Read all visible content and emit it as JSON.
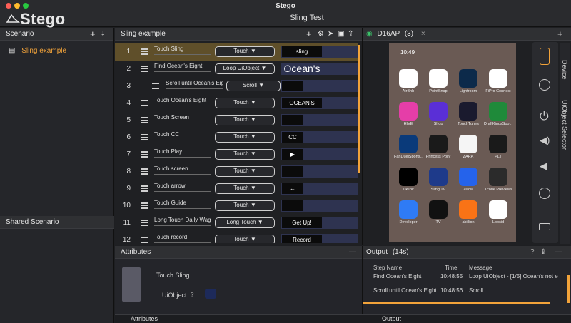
{
  "window": {
    "title": "Stego",
    "document_title": "Sling Test",
    "logo": "Stego"
  },
  "left": {
    "scenario_header": "Scenario",
    "scenario_items": [
      "Sling example"
    ],
    "shared_header": "Shared Scenario"
  },
  "sling": {
    "header": "Sling example",
    "rows": [
      {
        "num": "1",
        "label": "Touch Sling",
        "action": "Touch ▼",
        "thumb": "sling"
      },
      {
        "num": "2",
        "label": "Find Ocean's Eight",
        "action": "Loop UiObject ▼",
        "thumb": "Ocean's"
      },
      {
        "num": "3",
        "label": "Scroll until Ocean's Eight",
        "action": "Scroll ▼",
        "thumb": ""
      },
      {
        "num": "4",
        "label": "Touch Ocean's Eight",
        "action": "Touch ▼",
        "thumb": "OCEAN'S"
      },
      {
        "num": "5",
        "label": "Touch Screen",
        "action": "Touch ▼",
        "thumb": ""
      },
      {
        "num": "6",
        "label": "Touch CC",
        "action": "Touch ▼",
        "thumb": "CC"
      },
      {
        "num": "7",
        "label": "Touch Play",
        "action": "Touch ▼",
        "thumb": "▶"
      },
      {
        "num": "8",
        "label": "Touch screen",
        "action": "Touch ▼",
        "thumb": ""
      },
      {
        "num": "9",
        "label": "Touch arrow",
        "action": "Touch ▼",
        "thumb": "←"
      },
      {
        "num": "10",
        "label": "Touch Guide",
        "action": "Touch ▼",
        "thumb": ""
      },
      {
        "num": "11",
        "label": "Long Touch Daily Wage",
        "action": "Long Touch ▼",
        "thumb": "Get Up!"
      },
      {
        "num": "12",
        "label": "Touch record",
        "action": "Touch ▼",
        "thumb": "Record"
      }
    ]
  },
  "attributes": {
    "header": "Attributes",
    "action_name": "Touch Sling",
    "field_label": "UiObject",
    "footer_tab": "Attributes"
  },
  "device": {
    "tab_label": "D16AP",
    "tab_count": "(3)",
    "side_tabs": [
      "Device",
      "UiObject Selector"
    ],
    "clock": "10:49",
    "apps": [
      [
        "AirBnb",
        "PointSnap",
        "Lightroom",
        "FiPro Connect"
      ],
      [
        "HIVE",
        "Shop",
        "TouchTunes",
        "DraftKingsSpo..."
      ],
      [
        "FanDuelSports...",
        "Princess Polly",
        "ZARA",
        "PLT"
      ],
      [
        "TikTok",
        "Sling TV",
        "Zillow",
        "Xcode Previews"
      ],
      [
        "Developer",
        "TV",
        "abillion",
        "Loosid"
      ]
    ]
  },
  "output": {
    "header": "Output",
    "count": "(14s)",
    "columns": [
      "Step Name",
      "Time",
      "Message"
    ],
    "rows": [
      {
        "step": "Find Ocean's Eight",
        "time": "10:48:55",
        "message": "Loop UiObject - [1/5] Ocean's not e"
      },
      {
        "step": "Scroll until Ocean's Eight",
        "time": "10:48:56",
        "message": "Scroll"
      }
    ],
    "footer_tab": "Output"
  },
  "colors": {
    "accent": "#f2a33a",
    "thumb_bg": "#2e3350"
  }
}
